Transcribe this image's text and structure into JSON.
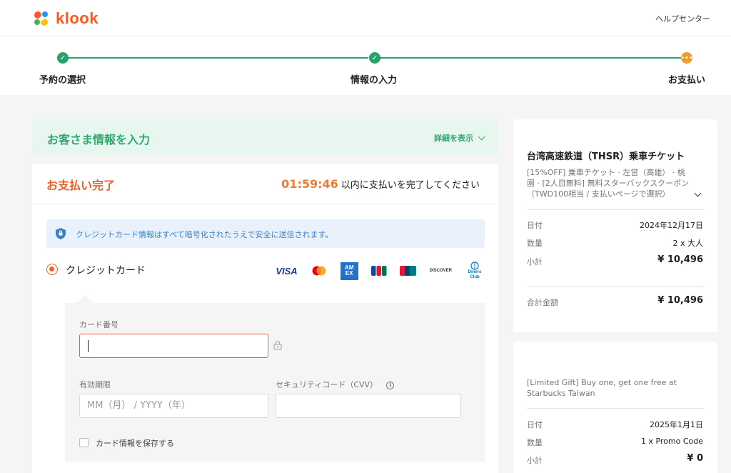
{
  "header": {
    "brand": "klook",
    "help_label": "ヘルプセンター"
  },
  "stepper": {
    "steps": [
      {
        "label": "予約の選択",
        "state": "done"
      },
      {
        "label": "情報の入力",
        "state": "done"
      },
      {
        "label": "お支払い",
        "state": "active"
      }
    ]
  },
  "guest_info": {
    "title": "お客さま情報を入力",
    "detail_label": "詳細を表示"
  },
  "payment": {
    "title": "お支払い完了",
    "timer": "01:59:46",
    "timer_suffix": "以内に支払いを完了してください",
    "secure_note": "クレジットカード情報はすべて暗号化されたうえで安全に送信されます。",
    "method_label": "クレジットカード",
    "brand_icons": [
      "visa-icon",
      "mastercard-icon",
      "amex-icon",
      "jcb-icon",
      "unionpay-icon",
      "discover-icon",
      "diners-club-icon"
    ],
    "brand_text": {
      "visa": "VISA",
      "amex": "AM EX",
      "discover": "DISCOVER",
      "diners": "Diners Club"
    },
    "card_number_label": "カード番号",
    "card_number_value": "",
    "expiry_label": "有効期限",
    "expiry_placeholder": "MM（月） / YYYY（年）",
    "cvv_label": "セキュリティコード（CVV）",
    "cvv_value": "",
    "save_card_label": "カード情報を保存する"
  },
  "summary": {
    "title": "台湾高速鉄道（THSR）乗車チケット",
    "description": "[15%OFF] 乗車チケット · 左営（高雄） · 桃園 · [2人目無料] 無料スターバックスクーポン（TWD100相当 / 支払いページで選択）",
    "rows": [
      {
        "label": "日付",
        "value": "2024年12月17日"
      },
      {
        "label": "数量",
        "value": "2 x 大人"
      },
      {
        "label": "小計",
        "value": "¥ 10,496"
      }
    ],
    "total_label": "合計金額",
    "total_value": "¥ 10,496"
  },
  "gift": {
    "description": "[Limited Gift] Buy one, get one free at Starbucks Taiwan",
    "rows": [
      {
        "label": "日付",
        "value": "2025年1月1日"
      },
      {
        "label": "数量",
        "value": "1 x Promo Code"
      },
      {
        "label": "小計",
        "value": "¥ 0"
      }
    ]
  },
  "colors": {
    "brand": "#ff5722",
    "success": "#26a36b",
    "active_step": "#f09b2a",
    "accent": "#f05e28",
    "info": "#3b82c4"
  }
}
